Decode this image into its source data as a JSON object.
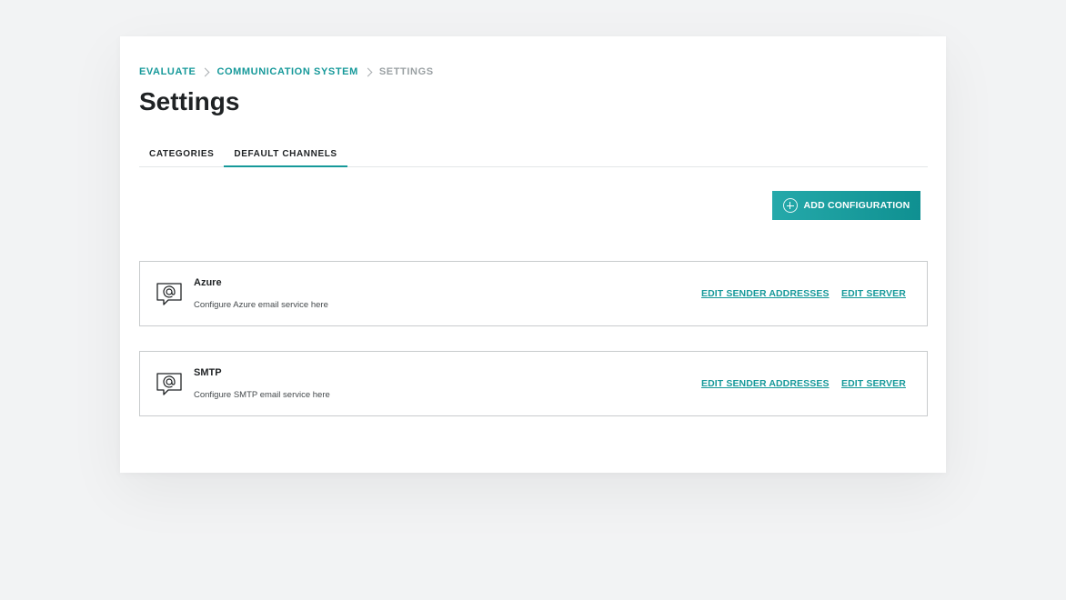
{
  "breadcrumb": {
    "items": [
      "EVALUATE",
      "COMMUNICATION SYSTEM",
      "SETTINGS"
    ]
  },
  "page": {
    "title": "Settings"
  },
  "tabs": [
    {
      "label": "CATEGORIES",
      "active": false
    },
    {
      "label": "DEFAULT CHANNELS",
      "active": true
    }
  ],
  "toolbar": {
    "add_label": "ADD CONFIGURATION",
    "add_icon": "plus-circle-icon"
  },
  "channels": [
    {
      "name": "Azure",
      "description": "Configure Azure email service here",
      "icon": "email-chat-icon",
      "edit_senders_label": "EDIT SENDER ADDRESSES",
      "edit_server_label": "EDIT SERVER"
    },
    {
      "name": "SMTP",
      "description": "Configure SMTP email service here",
      "icon": "email-chat-icon",
      "edit_senders_label": "EDIT SENDER ADDRESSES",
      "edit_server_label": "EDIT SERVER"
    }
  ],
  "colors": {
    "accent": "#16999a",
    "text": "#1f2224",
    "muted": "#9aa0a3",
    "border": "#c8cbcd"
  }
}
